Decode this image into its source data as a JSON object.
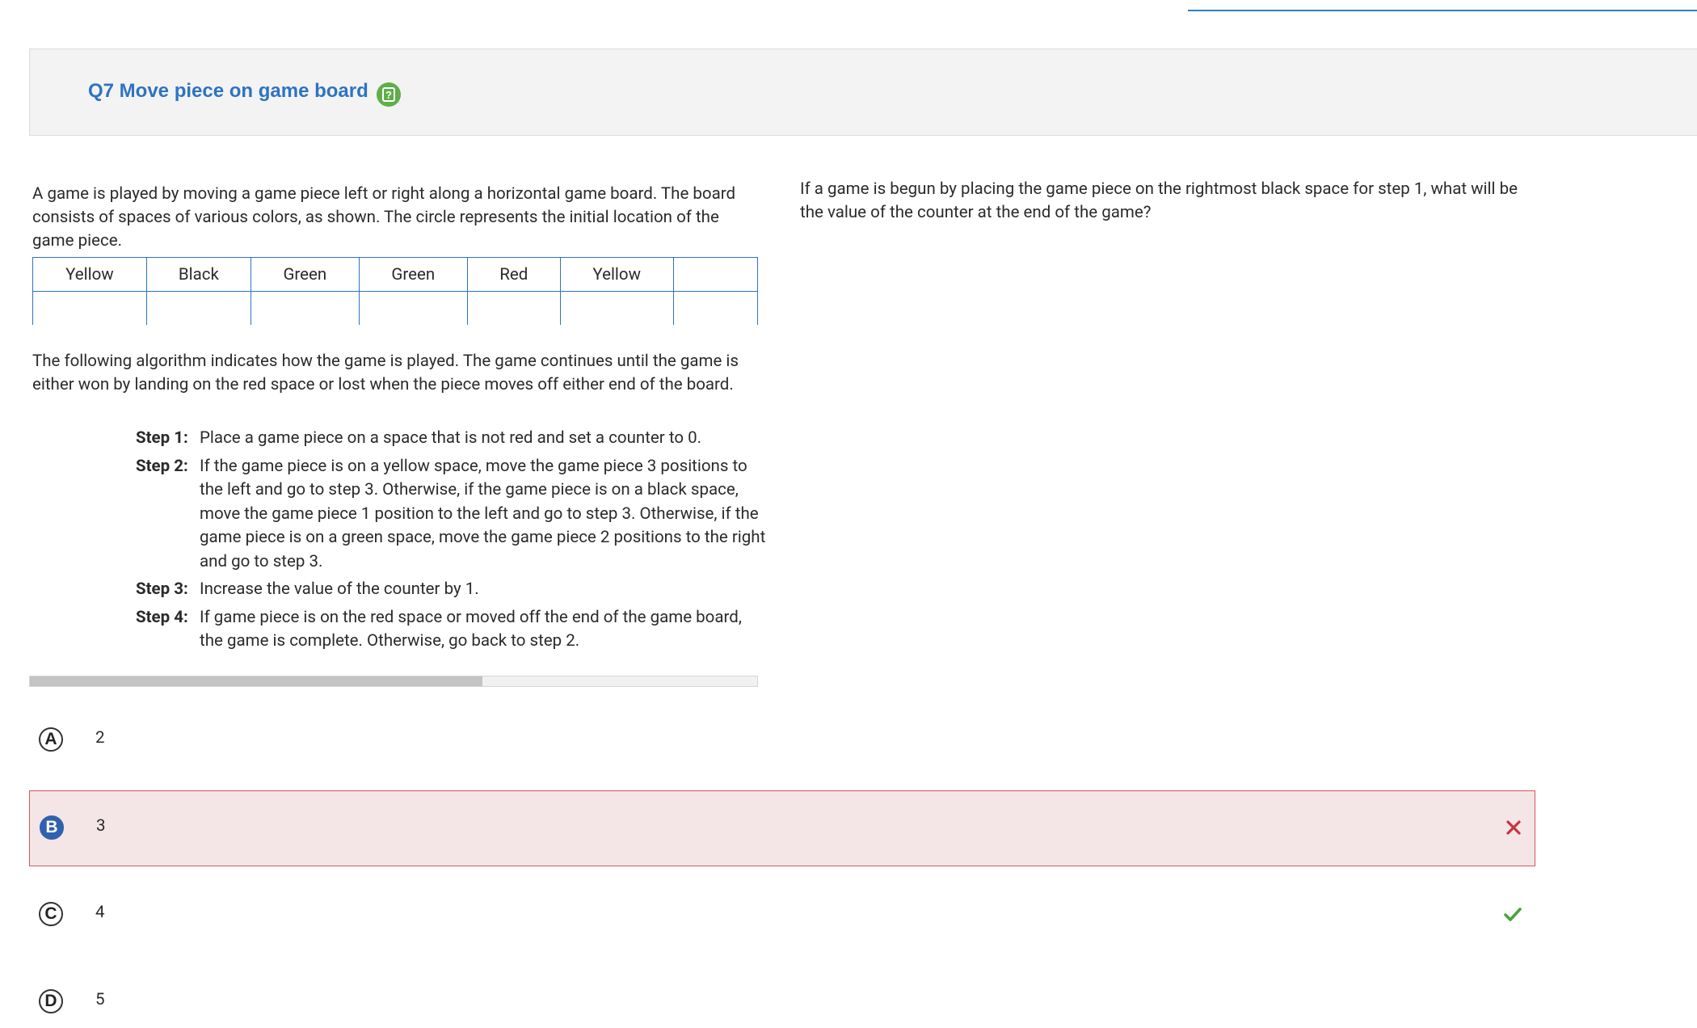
{
  "header": {
    "title": "Q7 Move piece on game board",
    "help_icon": "help-icon",
    "timer_icon": "timer-icon"
  },
  "passage": {
    "intro": "A game is played by moving a game piece left or right along a horizontal game board. The board consists of spaces of various colors, as shown. The circle represents the initial location of the game piece.",
    "board_colors": [
      "Yellow",
      "Black",
      "Green",
      "Green",
      "Red",
      "Yellow",
      ""
    ],
    "algorithm_intro": "The following algorithm indicates how the game is played. The game continues until the game is either won by landing on the red space or lost when the piece moves off either end of the board.",
    "steps": [
      {
        "label": "Step 1:",
        "text": "Place a game piece on a space that is not red and set a counter to 0."
      },
      {
        "label": "Step 2:",
        "text": "If the game piece is on a yellow space, move the game piece 3 positions to the left and go to step 3. Otherwise, if the game piece is on a black space, move the game piece 1 position to the left and go to step 3. Otherwise, if the game piece is on a green space, move the game piece 2 positions to the right and go to step 3."
      },
      {
        "label": "Step 3:",
        "text": "Increase the value of the counter by 1."
      },
      {
        "label": "Step 4:",
        "text": "If game piece is on the red space or moved off the end of the game board, the game is complete. Otherwise, go back to step 2."
      }
    ]
  },
  "question": {
    "text": "If a game is begun by placing the game piece on the rightmost black space for step 1, what will be the value of the counter at the end of the game?"
  },
  "options": [
    {
      "letter": "A",
      "value": "2",
      "selected": false,
      "status": ""
    },
    {
      "letter": "B",
      "value": "3",
      "selected": true,
      "status": "incorrect"
    },
    {
      "letter": "C",
      "value": "4",
      "selected": false,
      "status": "correct"
    },
    {
      "letter": "D",
      "value": "5",
      "selected": false,
      "status": ""
    }
  ],
  "colors": {
    "accent": "#2f73c1",
    "incorrect": "#c9343f",
    "correct": "#4aa33c",
    "selected_bg": "#f4e5e6"
  }
}
